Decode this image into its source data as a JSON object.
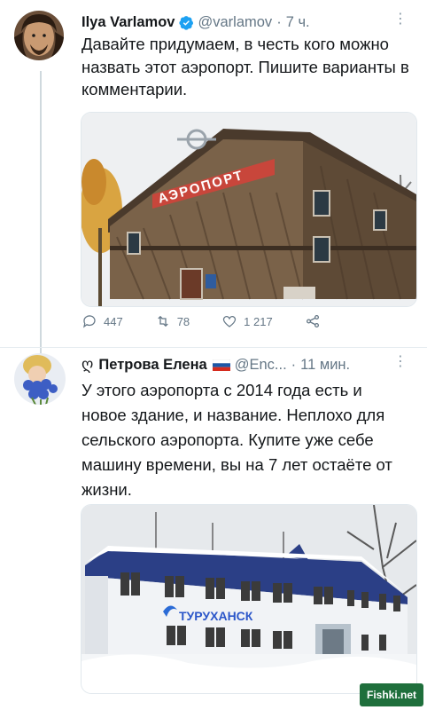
{
  "tweets": [
    {
      "author_name": "Ilya Varlamov",
      "handle": "@varlamov",
      "separator": "·",
      "time": "7 ч.",
      "text": "Давайте придумаем, в честь кого можно назвать этот аэропорт. Пишите варианты в комментарии.",
      "verified": true,
      "image_sign_text": "АЭРОПОРТ",
      "actions": {
        "replies": "447",
        "retweets": "78",
        "likes": "1 217"
      }
    },
    {
      "prefix_symbol": "ღ",
      "author_name": "Петрова Елена",
      "handle": "@Enc...",
      "separator": "·",
      "time": "11 мин.",
      "text": "У этого аэропорта с 2014 года есть и новое здание, и название. Неплохо для сельского аэропорта. Купите уже себе машину времени, вы на 7 лет остаёте от жизни.",
      "image_sign_text": "ТУРУХАНСК"
    }
  ],
  "watermark": "Fishki.net",
  "colors": {
    "verified": "#1da1f2",
    "secondary_text": "#657786",
    "thread_line": "#cfd9de"
  }
}
